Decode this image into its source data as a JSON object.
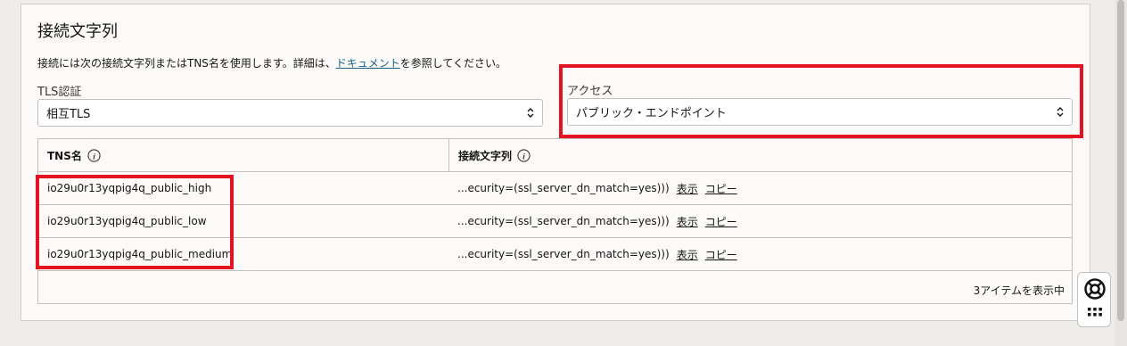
{
  "section": {
    "title": "接続文字列",
    "description_before": "接続には次の接続文字列またはTNS名を使用します。詳細は、",
    "description_link": "ドキュメント",
    "description_after": "を参照してください。"
  },
  "tls": {
    "label": "TLS認証",
    "value": "相互TLS"
  },
  "access": {
    "label": "アクセス",
    "value": "パブリック・エンドポイント"
  },
  "table": {
    "col_tns": "TNS名",
    "col_conn": "接続文字列",
    "rows": [
      {
        "tns": "io29u0r13yqpig4q_public_high",
        "conn": "...ecurity=(ssl_server_dn_match=yes)))",
        "show": "表示",
        "copy": "コピー"
      },
      {
        "tns": "io29u0r13yqpig4q_public_low",
        "conn": "...ecurity=(ssl_server_dn_match=yes)))",
        "show": "表示",
        "copy": "コピー"
      },
      {
        "tns": "io29u0r13yqpig4q_public_medium",
        "conn": "...ecurity=(ssl_server_dn_match=yes)))",
        "show": "表示",
        "copy": "コピー"
      }
    ],
    "footer": "3アイテムを表示中"
  },
  "colors": {
    "highlight": "#e3141f",
    "link": "#1a6287"
  },
  "icons": [
    "info-icon",
    "chevron-updown-icon",
    "lifebuoy-icon",
    "grid-icon"
  ]
}
